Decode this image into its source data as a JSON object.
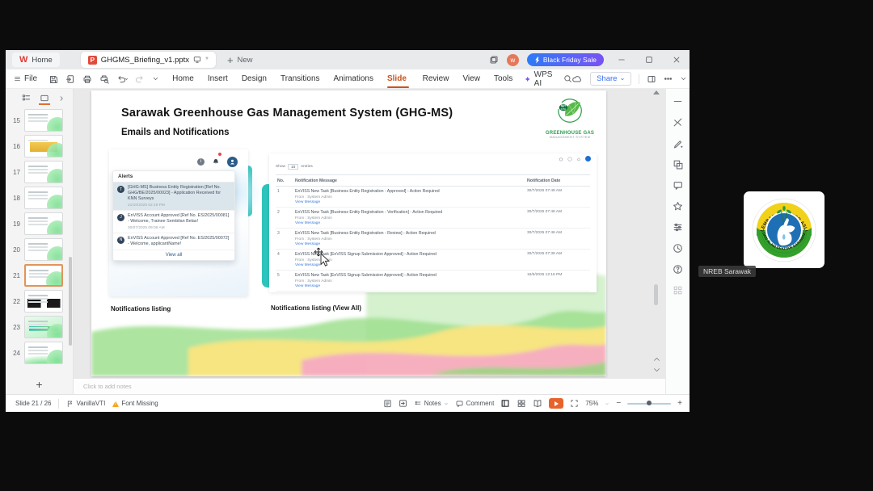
{
  "titlebar": {
    "wps_logo": "W",
    "home_tab": "Home",
    "ppt_icon": "P",
    "doc_tab": "GHGMS_Briefing_v1.pptx",
    "doc_modified": "*",
    "new_tab": "New",
    "promo": "Black Friday Sale"
  },
  "menubar": {
    "file": "File",
    "items": [
      "Home",
      "Insert",
      "Design",
      "Transitions",
      "Animations",
      "Slide Show",
      "Review",
      "View",
      "Tools"
    ],
    "active_item": "Slide Show",
    "wps_ai": "WPS AI",
    "share": "Share"
  },
  "thumbnails": {
    "items": [
      {
        "num": "15",
        "variant": "doc"
      },
      {
        "num": "16",
        "variant": "yellow"
      },
      {
        "num": "17",
        "variant": "doc"
      },
      {
        "num": "18",
        "variant": "doc"
      },
      {
        "num": "19",
        "variant": "doc"
      },
      {
        "num": "20",
        "variant": "doc"
      },
      {
        "num": "21",
        "variant": "doc",
        "selected": true
      },
      {
        "num": "22",
        "variant": "dark"
      },
      {
        "num": "23",
        "variant": "green"
      },
      {
        "num": "24",
        "variant": "wave"
      }
    ],
    "add_label": "+"
  },
  "slide": {
    "title": "Sarawak Greenhouse Gas Management System (GHG-MS)",
    "subtitle": "Emails and Notifications",
    "logo": {
      "badge_line1": "NET",
      "badge_line2": "2050",
      "line1": "GREENHOUSE GAS",
      "line2": "MANAGEMENT SYSTEM"
    },
    "captions": {
      "left": "Notifications listing",
      "right": "Notifications listing (View All)"
    },
    "alerts_panel": {
      "header": "Alerts",
      "items": [
        {
          "initial": "T",
          "text": "[GHG-MS] Business Entity Registration [Ref No. GHG/BE/2025/00023] - Application Received for KNN Surveys",
          "time": "21/10/2025 02:19 PM",
          "highlight": true
        },
        {
          "initial": "J",
          "text": "EnVISS Account Approved [Ref No. ES/2025/00081] - Welcome, Trainee Sembilan Belas!",
          "time": "30/07/2025 09:09 AM",
          "highlight": false
        },
        {
          "initial": "N",
          "text": "EnVISS Account Approved [Ref No. ES/2025/00072] - Welcome, applicantName!",
          "time": "",
          "highlight": false
        }
      ],
      "view_all": "View all"
    },
    "table_panel": {
      "show_prefix": "Show",
      "show_value": "10",
      "show_suffix": "entries",
      "headers": [
        "No.",
        "Notification Message",
        "Notification Date"
      ],
      "rows": [
        {
          "no": "1",
          "message": "EnVISS New Task [Business Entity Registration - Approved] - Action Required",
          "from": "From : System Admin",
          "link": "View Message",
          "date": "30/7/2025 07:49 AM"
        },
        {
          "no": "2",
          "message": "EnVISS New Task [Business Entity Registration - Verification] - Action Required",
          "from": "From : System Admin",
          "link": "View Message",
          "date": "30/7/2025 07:48 AM"
        },
        {
          "no": "3",
          "message": "EnVISS New Task [Business Entity Registration - Review] - Action Required",
          "from": "From : System Admin",
          "link": "View Message",
          "date": "30/7/2025 07:46 AM"
        },
        {
          "no": "4",
          "message": "EnVISS New Task [EnVISS Signup Submission Approved] - Action Required",
          "from": "From : System Admin",
          "link": "View Message",
          "date": "30/7/2025 07:39 AM"
        },
        {
          "no": "5",
          "message": "EnVISS New Task [EnVISS Signup Submission Approved] - Action Required",
          "from": "From : System Admin",
          "link": "View Message",
          "date": "16/6/2025 12:16 PM"
        }
      ]
    }
  },
  "notes_placeholder": "Click to add notes",
  "statusbar": {
    "slide_info": "Slide 21 / 26",
    "design_name": "VanillaVTI",
    "font_missing": "Font Missing",
    "notes": "Notes",
    "comment": "Comment",
    "zoom_level": "75%"
  },
  "right_toolbar_icons": [
    "collapse",
    "design",
    "ai-pen",
    "shapes",
    "comment",
    "star",
    "settings",
    "history",
    "help",
    "apps"
  ],
  "meeting": {
    "participant_name": "NREB Sarawak",
    "badge": {
      "top_text": "LEMBAGA SUMBER ASLI",
      "bottom_text": "DAN ALAM SEKITAR SARAWAK"
    }
  }
}
